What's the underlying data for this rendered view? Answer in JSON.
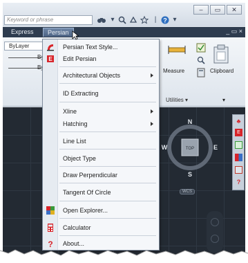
{
  "search": {
    "placeholder": "Keyword or phrase"
  },
  "quick_access_icons": [
    "binoculars-icon",
    "star-icon",
    "help-icon"
  ],
  "window_controls": [
    "minimize",
    "restore",
    "close"
  ],
  "tabs": [
    {
      "label": "Express"
    },
    {
      "label": "Persian"
    }
  ],
  "ribbon": {
    "layer_value": "ByLayer",
    "by_text_1": "By",
    "by_text_2": "By",
    "measure_label": "Measure",
    "utilities_label": "Utilities ▾",
    "clipboard_label": "Clipboard"
  },
  "viewcube": {
    "north": "N",
    "south": "S",
    "east": "E",
    "west": "W",
    "top": "TOP",
    "wcs": "WCS"
  },
  "menu": {
    "items": [
      {
        "label": "Persian Text Style...",
        "icon": "persian-text-style-icon",
        "submenu": false
      },
      {
        "label": "Edit Persian",
        "icon": "edit-persian-icon",
        "submenu": false
      },
      {
        "label": "Architectural Objects",
        "icon": "",
        "submenu": true
      },
      {
        "label": "ID Extracting",
        "icon": "",
        "submenu": false
      },
      {
        "label": "Xline",
        "icon": "",
        "submenu": true
      },
      {
        "label": "Hatching",
        "icon": "",
        "submenu": true
      },
      {
        "label": "Line List",
        "icon": "",
        "submenu": false
      },
      {
        "label": "Object Type",
        "icon": "",
        "submenu": false
      },
      {
        "label": "Draw Perpendicular",
        "icon": "",
        "submenu": false
      },
      {
        "label": "Tangent Of Circle",
        "icon": "",
        "submenu": false
      },
      {
        "label": "Open Explorer...",
        "icon": "explorer-icon",
        "submenu": false
      },
      {
        "label": "Calculator",
        "icon": "calculator-icon",
        "submenu": false
      },
      {
        "label": "About...",
        "icon": "about-icon",
        "submenu": false
      }
    ]
  },
  "colors": {
    "tab_bar": "#2e3c4f",
    "canvas": "#232a33",
    "menu_bg": "#f5f7fa",
    "accent_red": "#d8242a"
  }
}
